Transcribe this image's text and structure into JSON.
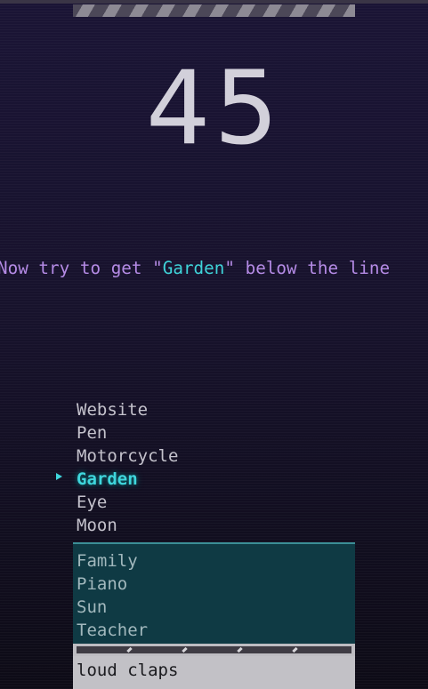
{
  "score": "45",
  "instruction": {
    "prefix": "Now try to get \"",
    "target": "Garden",
    "suffix": "\" below the line"
  },
  "upper_words": [
    "Website",
    "Pen",
    "Motorcycle",
    "Garden",
    "Eye",
    "Moon"
  ],
  "selected_word": "Garden",
  "lower_words": [
    "Family",
    "Piano",
    "Sun",
    "Teacher"
  ],
  "input_text": "loud claps",
  "timer_remaining_fraction": 1.0,
  "colors": {
    "background": "#15102a",
    "score_text": "#d2d0da",
    "instruction_text": "#b58be6",
    "target_highlight": "#3fd6dc",
    "lower_zone": "#0f3a44",
    "input_box": "#c2c1c6"
  }
}
